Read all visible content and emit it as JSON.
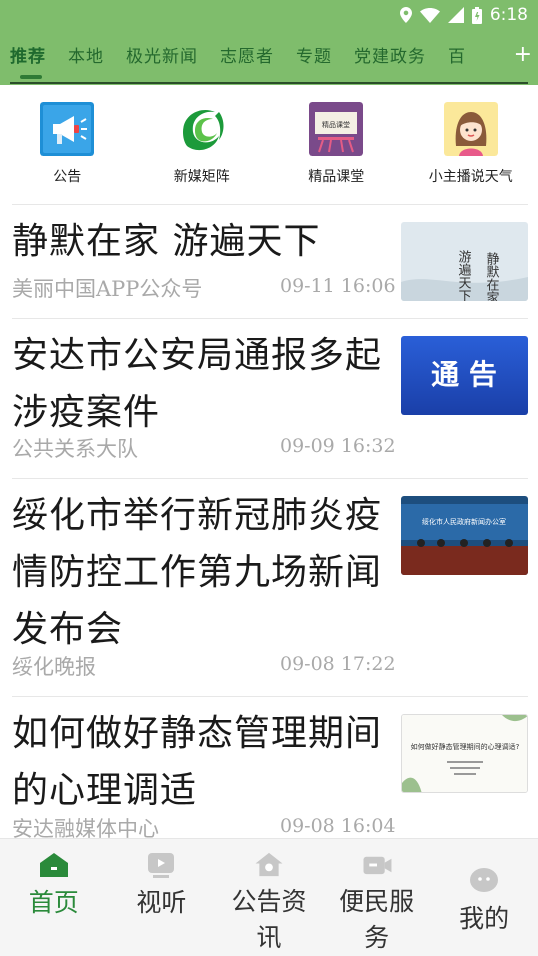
{
  "status_bar": {
    "time": "6:18"
  },
  "nav": {
    "tabs": [
      "推荐",
      "本地",
      "极光新闻",
      "志愿者",
      "专题",
      "党建政务",
      "百"
    ],
    "add_label": "+"
  },
  "quick_links": [
    {
      "label": "公告",
      "icon": "megaphone-icon"
    },
    {
      "label": "新媒矩阵",
      "icon": "swirl-logo-icon"
    },
    {
      "label": "精品课堂",
      "icon": "classroom-board-icon"
    },
    {
      "label": "小主播说天气",
      "icon": "anchor-girl-icon"
    }
  ],
  "news": [
    {
      "title": "静默在家 游遍天下",
      "source": "美丽中国APP公众号",
      "time": "09-11 16:06",
      "thumb_text": "游遍天下 静默在家"
    },
    {
      "title": "安达市公安局通报多起涉疫案件",
      "source": "公共关系大队",
      "time": "09-09 16:32",
      "thumb_text": "通 告"
    },
    {
      "title": "绥化市举行新冠肺炎疫情防控工作第九场新闻发布会",
      "source": "绥化晚报",
      "time": "09-08 17:22",
      "thumb_text": "绥化市人民政府新闻办公室"
    },
    {
      "title": "如何做好静态管理期间的心理调适",
      "source": "安达融媒体中心",
      "time": "09-08 16:04",
      "thumb_text": "如何做好静态管理期间的心理调适?"
    }
  ],
  "bottom_nav": [
    {
      "label": "首页",
      "icon": "home-icon",
      "active": true
    },
    {
      "label": "视听",
      "icon": "video-icon",
      "active": false
    },
    {
      "label": "公告资讯",
      "icon": "house-notice-icon",
      "active": false
    },
    {
      "label": "便民服务",
      "icon": "camera-icon",
      "active": false
    },
    {
      "label": "我的",
      "icon": "chat-bubble-icon",
      "active": false
    }
  ],
  "colors": {
    "accent": "#7fbd6c",
    "active_green": "#2a8a3a"
  }
}
